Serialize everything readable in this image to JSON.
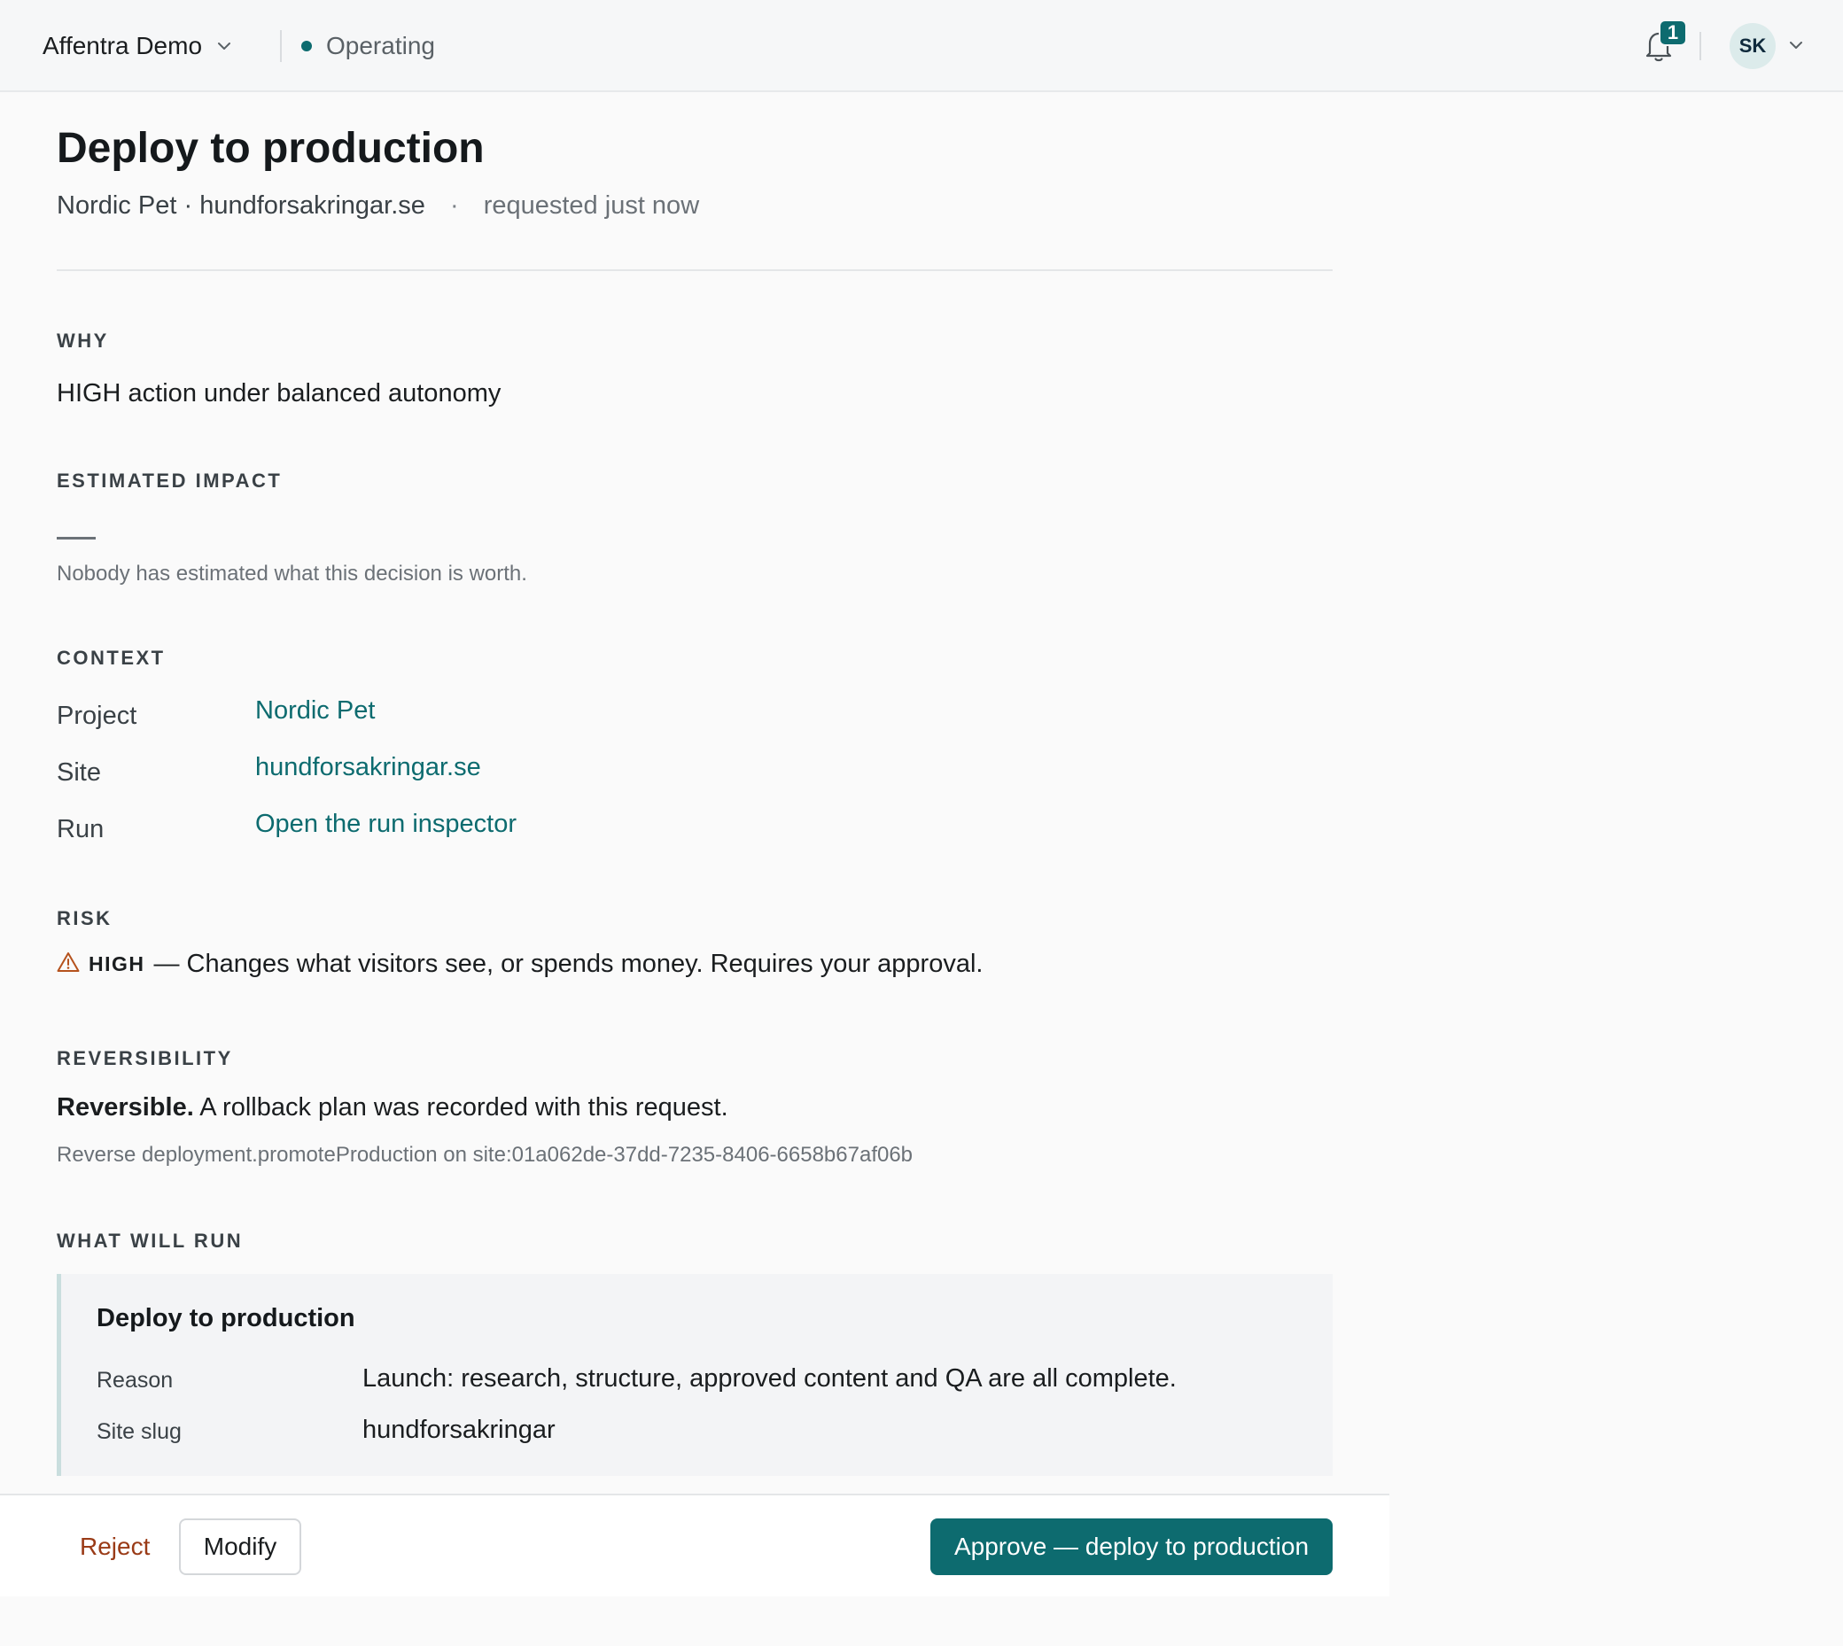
{
  "header": {
    "org_name": "Affentra Demo",
    "status": "Operating",
    "notification_count": "1",
    "user_initials": "SK",
    "icons": {
      "org_chevron": "chevron-down-icon",
      "status": "status-dot-icon",
      "bell": "bell-icon",
      "user_chevron": "chevron-down-icon"
    }
  },
  "request": {
    "title": "Deploy to production",
    "project": "Nordic Pet",
    "site": "hundforsakringar.se",
    "middot": "·",
    "requested": "requested just now"
  },
  "why": {
    "label": "WHY",
    "text": "HIGH action under balanced autonomy"
  },
  "impact": {
    "label": "ESTIMATED IMPACT",
    "note": "Nobody has estimated what this decision is worth."
  },
  "context": {
    "label": "CONTEXT",
    "rows": [
      {
        "key": "Project",
        "value": "Nordic Pet"
      },
      {
        "key": "Site",
        "value": "hundforsakringar.se"
      },
      {
        "key": "Run",
        "value": "Open the run inspector"
      }
    ]
  },
  "risk": {
    "label": "RISK",
    "icon": "warning-triangle-icon",
    "level": "HIGH",
    "description": "— Changes what visitors see, or spends money. Requires your approval.",
    "accent": "#b5521d"
  },
  "reversibility": {
    "label": "REVERSIBILITY",
    "status": "Reversible.",
    "text": "A rollback plan was recorded with this request.",
    "detail": "Reverse deployment.promoteProduction on site:01a062de-37dd-7235-8406-6658b67af06b"
  },
  "what_will_run": {
    "label": "WHAT WILL RUN",
    "title": "Deploy to production",
    "rows": [
      {
        "key": "Reason",
        "value": "Launch: research, structure, approved content and QA are all complete."
      },
      {
        "key": "Site slug",
        "value": "hundforsakringar"
      }
    ]
  },
  "actions": {
    "reject": "Reject",
    "modify": "Modify",
    "approve": "Approve — deploy to production"
  },
  "colors": {
    "accent": "#0d6b6f",
    "reject": "#9a3b17"
  }
}
